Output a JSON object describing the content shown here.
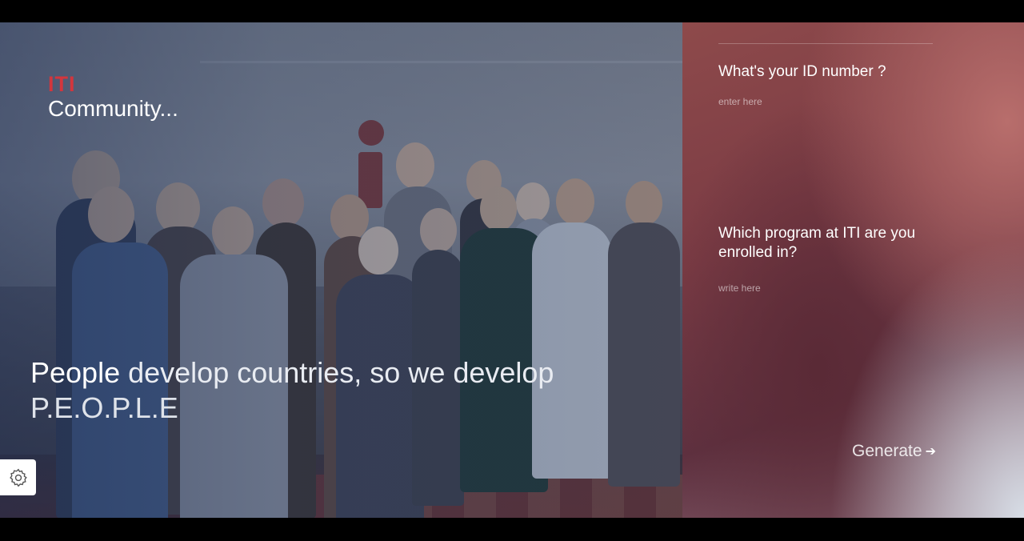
{
  "hero": {
    "brand": "ITI",
    "subtitle": "Community...",
    "tagline_strong": "People",
    "tagline_rest": " develop countries, so we develop",
    "tagline_people": "P.E.O.P.L.E"
  },
  "form": {
    "id_question": "What's your ID number ?",
    "id_placeholder": "enter here",
    "program_question": "Which program at ITI are you enrolled in?",
    "program_placeholder": "write here",
    "generate_label": "Generate",
    "generate_arrow": "➔"
  },
  "settings": {
    "icon": "gear-icon"
  },
  "colors": {
    "brand_red": "#d3363d",
    "panel_base": "#7a3b44"
  }
}
